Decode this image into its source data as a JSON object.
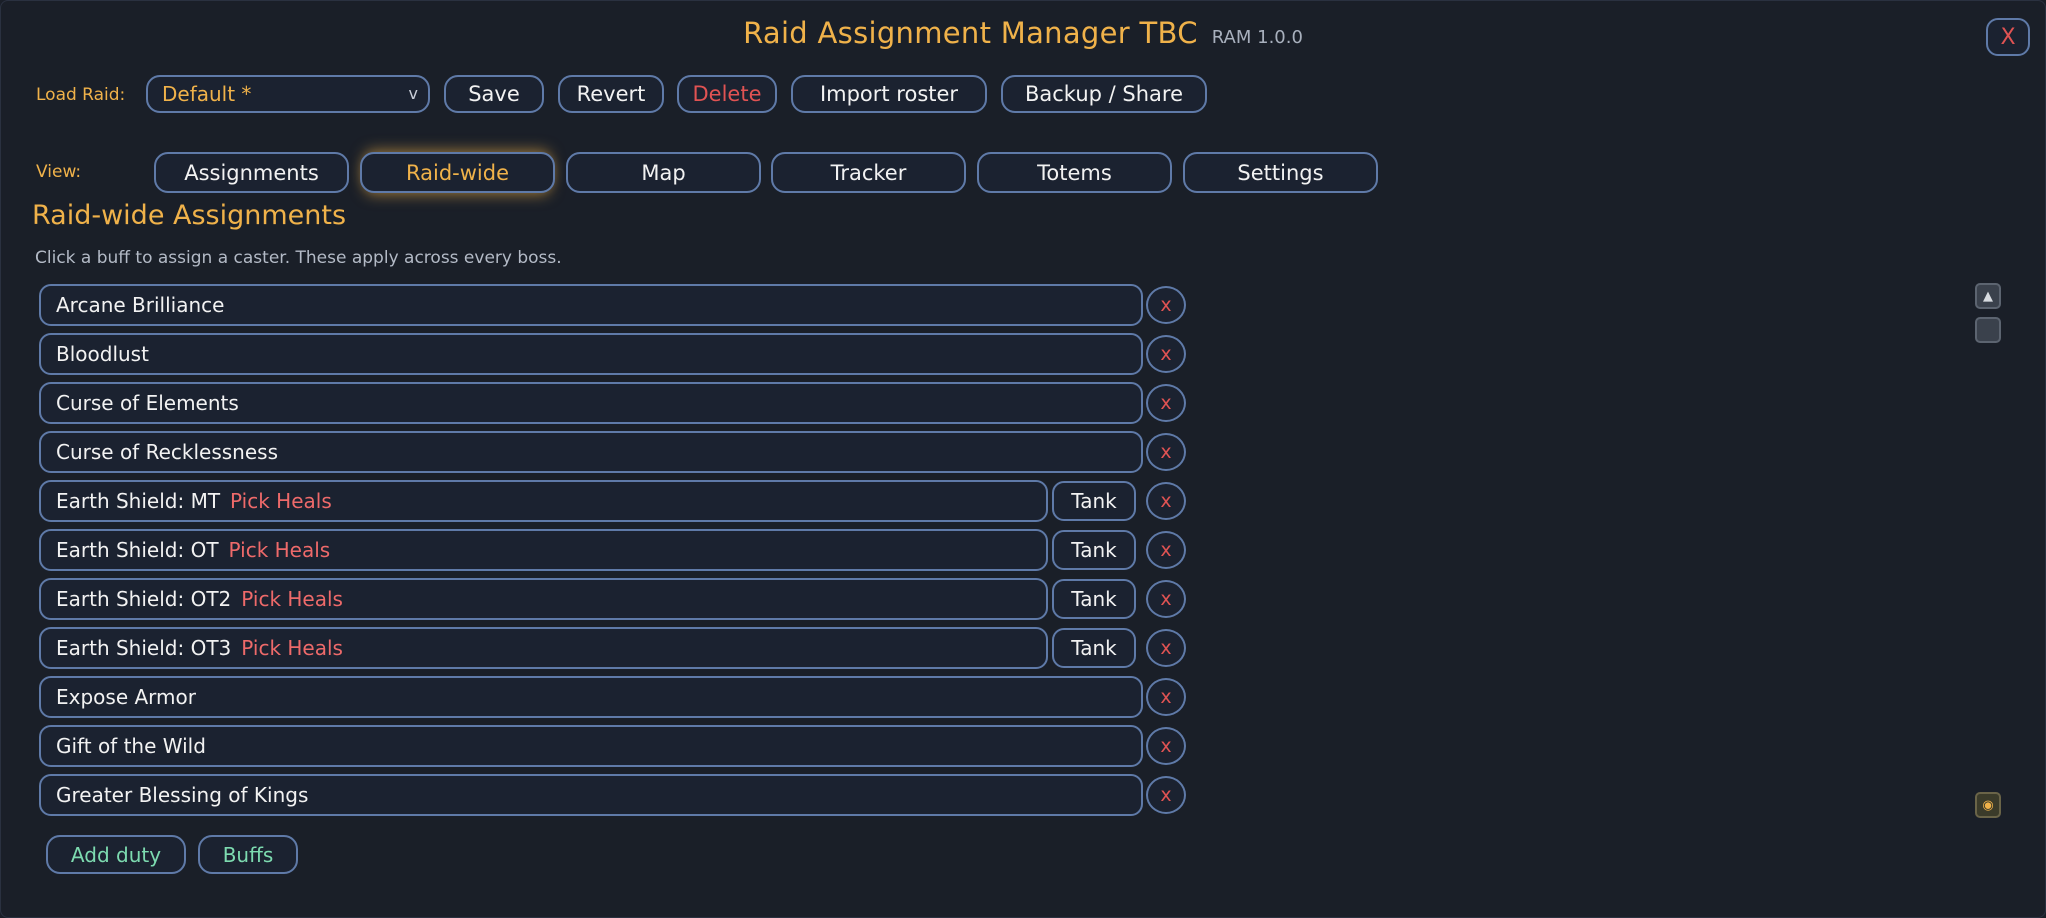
{
  "header": {
    "title": "Raid Assignment Manager TBC",
    "version": "RAM 1.0.0",
    "close_label": "X"
  },
  "toolbar": {
    "load_label": "Load Raid:",
    "raid_select": "Default *",
    "chevron": "v",
    "save": "Save",
    "revert": "Revert",
    "delete": "Delete",
    "import": "Import roster",
    "backup": "Backup / Share"
  },
  "view": {
    "label": "View:",
    "tabs": [
      "Assignments",
      "Raid-wide",
      "Map",
      "Tracker",
      "Totems",
      "Settings"
    ],
    "active": "Raid-wide"
  },
  "section": {
    "title": "Raid-wide Assignments",
    "hint": "Click a buff to assign a caster. These apply across every boss."
  },
  "rows": [
    {
      "name": "Arcane Brilliance",
      "remove": "x"
    },
    {
      "name": "Bloodlust",
      "remove": "x"
    },
    {
      "name": "Curse of Elements",
      "remove": "x"
    },
    {
      "name": "Curse of Recklessness",
      "remove": "x"
    },
    {
      "name": "Earth Shield: MT",
      "pick": "Pick Heals",
      "tank": "Tank",
      "remove": "x"
    },
    {
      "name": "Earth Shield: OT",
      "pick": "Pick Heals",
      "tank": "Tank",
      "remove": "x"
    },
    {
      "name": "Earth Shield: OT2",
      "pick": "Pick Heals",
      "tank": "Tank",
      "remove": "x"
    },
    {
      "name": "Earth Shield: OT3",
      "pick": "Pick Heals",
      "tank": "Tank",
      "remove": "x"
    },
    {
      "name": "Expose Armor",
      "remove": "x"
    },
    {
      "name": "Gift of the Wild",
      "remove": "x"
    },
    {
      "name": "Greater Blessing of Kings",
      "remove": "x"
    }
  ],
  "footer": {
    "add_duty": "Add duty",
    "buffs": "Buffs"
  },
  "icons": {
    "scroll_up": "scroll-up-icon",
    "scroll_thumb": "scroll-thumb-icon",
    "minimap": "minimap-icon"
  },
  "colors": {
    "accent_gold": "#f0b24a",
    "danger_red": "#e05353",
    "pick_red": "#ee6a6a",
    "green": "#7ddbb0",
    "border_blue": "#5f7aa8",
    "background": "#1a1f28"
  }
}
